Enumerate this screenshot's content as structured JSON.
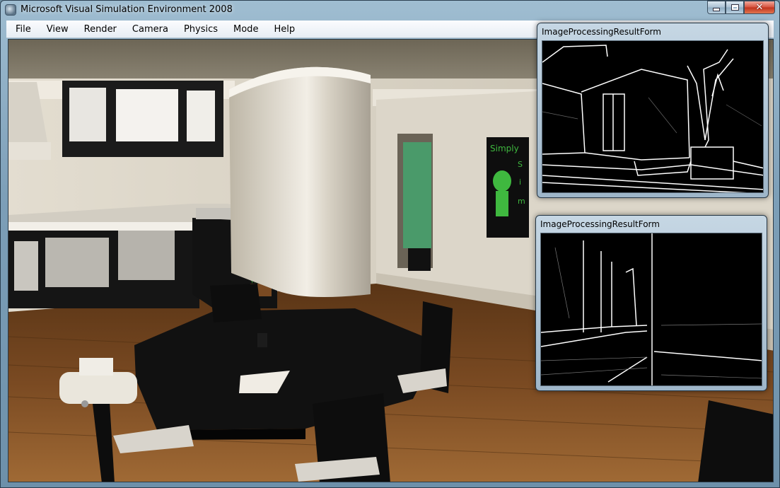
{
  "window": {
    "title": "Microsoft Visual Simulation Environment 2008",
    "icon": "app-icon",
    "controls": [
      "minimize-icon",
      "maximize-icon",
      "close-icon"
    ]
  },
  "menu": {
    "items": [
      "File",
      "View",
      "Render",
      "Camera",
      "Physics",
      "Mode",
      "Help"
    ]
  },
  "forms": [
    {
      "title": "ImageProcessingResultForm"
    },
    {
      "title": "ImageProcessingResultForm"
    }
  ],
  "scene": {
    "poster_text": [
      "Simply",
      "S",
      "i",
      "m"
    ]
  },
  "colors": {
    "floor": "#7a4a22",
    "wall": "#d8d2c4",
    "ceiling": "#8a8272",
    "table": "#111111",
    "cabinet": "#1a1a1a",
    "poster_green": "#3fb83f"
  }
}
